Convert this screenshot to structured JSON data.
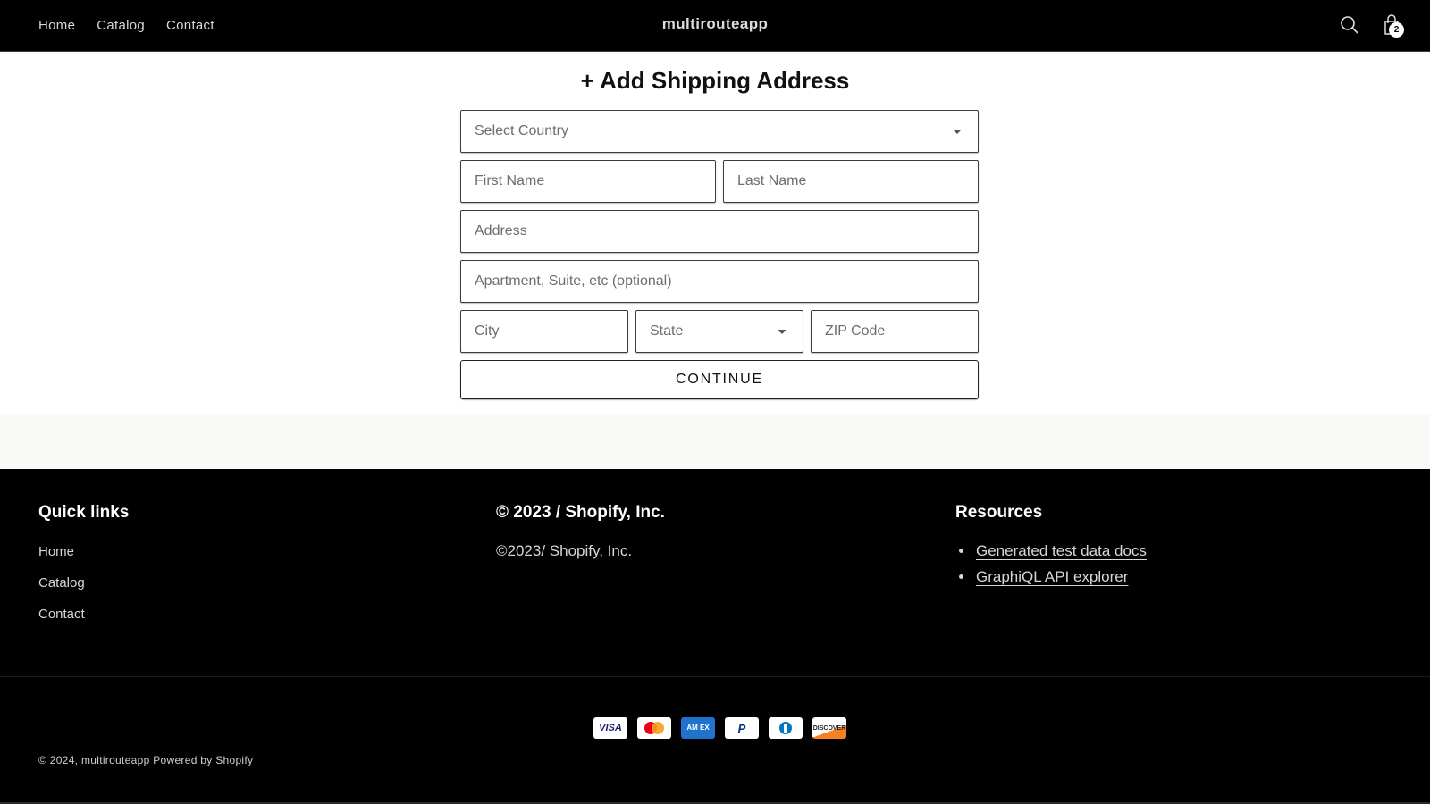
{
  "header": {
    "nav": [
      {
        "label": "Home"
      },
      {
        "label": "Catalog"
      },
      {
        "label": "Contact"
      }
    ],
    "brand": "multirouteapp",
    "search_icon": "search-icon",
    "cart_icon": "cart-icon",
    "cart_count": "2"
  },
  "form": {
    "title": "+ Add Shipping Address",
    "country": {
      "placeholder": "Select Country",
      "icon": "chevron-down-icon"
    },
    "first_name": {
      "placeholder": "First Name",
      "value": ""
    },
    "last_name": {
      "placeholder": "Last Name",
      "value": ""
    },
    "address": {
      "placeholder": "Address",
      "value": ""
    },
    "apartment": {
      "placeholder": "Apartment, Suite, etc (optional)",
      "value": ""
    },
    "city": {
      "placeholder": "City",
      "value": ""
    },
    "state": {
      "placeholder": "State",
      "icon": "chevron-down-icon"
    },
    "zip": {
      "placeholder": "ZIP Code",
      "value": ""
    },
    "continue_label": "CONTINUE"
  },
  "footer": {
    "quick_links": {
      "heading": "Quick links",
      "items": [
        {
          "label": "Home"
        },
        {
          "label": "Catalog"
        },
        {
          "label": "Contact"
        }
      ]
    },
    "about": {
      "heading": "© 2023 / Shopify, Inc.",
      "text": "©2023/ Shopify, Inc."
    },
    "resources": {
      "heading": "Resources",
      "items": [
        {
          "label": "Generated test data docs"
        },
        {
          "label": "GraphiQL API explorer"
        }
      ]
    },
    "payment_methods": [
      {
        "name": "Visa",
        "label": "VISA"
      },
      {
        "name": "Mastercard",
        "label": ""
      },
      {
        "name": "American Express",
        "label": "AM EX"
      },
      {
        "name": "PayPal",
        "label": "P"
      },
      {
        "name": "Diners Club",
        "label": ""
      },
      {
        "name": "Discover",
        "label": "DISCOVER"
      }
    ],
    "copyright_prefix": "© 2024, ",
    "copyright_store": "multirouteapp",
    "powered_by": "Powered by Shopify"
  },
  "colors": {
    "header_bg": "#000000",
    "footer_bg": "#000000",
    "spacer_bg": "#f9f9f7",
    "amex_blue": "#1f72cd",
    "discover_orange": "#f58220"
  }
}
